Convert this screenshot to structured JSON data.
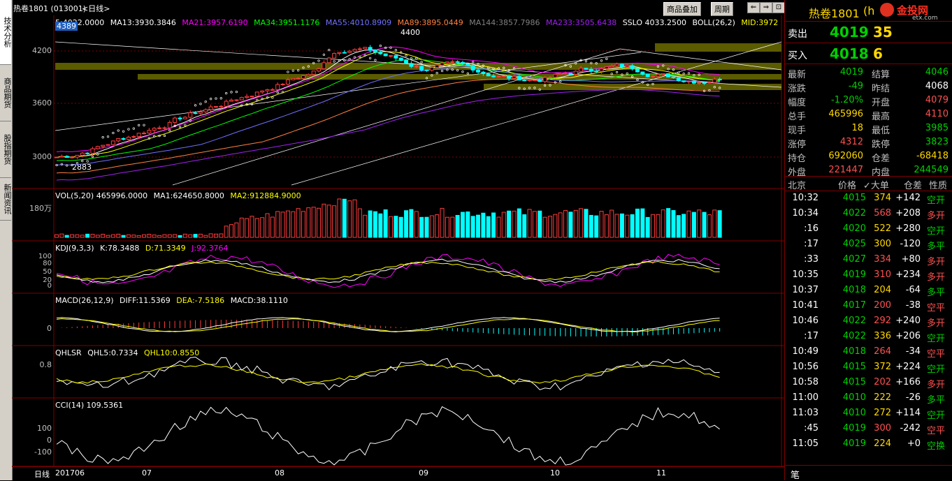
{
  "left_tabs": [
    "技术分析",
    "商品期货",
    "股指期货",
    "新闻资讯"
  ],
  "title": {
    "symbol": "热卷1801 (013001)",
    "period": "<日线>",
    "btn_overlay": "商品叠加",
    "btn_period": "周期"
  },
  "ma_header": {
    "close": "5:4022.0000",
    "ma13": "MA13:3930.3846",
    "ma21": "MA21:3957.6190",
    "ma34": "MA34:3951.1176",
    "ma55": "MA55:4010.8909",
    "ma89": "MA89:3895.0449",
    "ma144": "MA144:3857.7986",
    "ma233": "MA233:3505.6438",
    "sslo": "SSLO 4033.2500",
    "boll": "BOLL(26,2)",
    "mid": "MID:3972",
    "price_tag": "4389"
  },
  "price_axis": [
    "4200",
    "3600",
    "3000"
  ],
  "price_marks": {
    "high": "4400",
    "low": "2883"
  },
  "vol_header": {
    "label": "VOL(5,20) 465996.0000",
    "ma1": "MA1:624650.8000",
    "ma2": "MA2:912884.9000",
    "axis": "180万"
  },
  "kdj_header": {
    "label": "KDJ(9,3,3)",
    "k": "K:78.3488",
    "d": "D:71.3349",
    "j": "J:92.3764",
    "axis": [
      "100",
      "80",
      "50",
      "20",
      "0"
    ]
  },
  "macd_header": {
    "label": "MACD(26,12,9)",
    "diff": "DIFF:11.5369",
    "dea": "DEA:-7.5186",
    "macd": "MACD:38.1110",
    "axis": "0"
  },
  "qhlsr_header": {
    "label": "QHLSR",
    "q5": "QHL5:0.7334",
    "q10": "QHL10:0.8550",
    "axis": "0.8"
  },
  "cci_header": {
    "label": "CCI(14) 109.5361",
    "axis": [
      "100",
      "0",
      "-100"
    ]
  },
  "x_axis": {
    "label": "日线",
    "ticks": [
      "201706",
      "07",
      "08",
      "09",
      "10",
      "11"
    ]
  },
  "colors": {
    "up": "#ff3c3c",
    "down": "#00ffff",
    "ma13": "#ffffff",
    "ma21": "#ff00ff",
    "ma34": "#00ff00",
    "ma55": "#7070ff",
    "ma89": "#ff8040",
    "ma144": "#808080",
    "ma233": "#a020f0",
    "boll": "#ffd800",
    "mid": "#ffff00"
  },
  "quote": {
    "name": "热卷1801",
    "code": "(h",
    "brand": "金投网",
    "brand_sub": "etx.com",
    "sell": {
      "label": "卖出",
      "price": "4019",
      "vol": "35"
    },
    "buy": {
      "label": "买入",
      "price": "4018",
      "vol": "6"
    },
    "stats": [
      {
        "l1": "最新",
        "v1": "4019",
        "c1": "green",
        "l2": "结算",
        "v2": "4046",
        "c2": "green"
      },
      {
        "l1": "涨跌",
        "v1": "-49",
        "c1": "green",
        "l2": "昨结",
        "v2": "4068",
        "c2": "white"
      },
      {
        "l1": "幅度",
        "v1": "-1.20%",
        "c1": "green",
        "l2": "开盘",
        "v2": "4079",
        "c2": "red"
      },
      {
        "l1": "总手",
        "v1": "465996",
        "c1": "yellow",
        "l2": "最高",
        "v2": "4110",
        "c2": "red"
      },
      {
        "l1": "现手",
        "v1": "18",
        "c1": "yellow",
        "l2": "最低",
        "v2": "3985",
        "c2": "green"
      },
      {
        "l1": "涨停",
        "v1": "4312",
        "c1": "red",
        "l2": "跌停",
        "v2": "3823",
        "c2": "green"
      },
      {
        "l1": "持仓",
        "v1": "692060",
        "c1": "yellow",
        "l2": "仓差",
        "v2": "-68418",
        "c2": "yellow"
      },
      {
        "l1": "外盘",
        "v1": "221447",
        "c1": "red",
        "l2": "内盘",
        "v2": "244549",
        "c2": "green"
      }
    ],
    "tick_header": {
      "time": "北京",
      "price": "价格",
      "vol": "✓大单",
      "oi": "仓差",
      "nature": "性质"
    },
    "ticks": [
      {
        "t": "10:32",
        "p": "4015",
        "v": "374",
        "oi": "+142",
        "n": "空开",
        "vc": "yellow",
        "nc": "green"
      },
      {
        "t": "10:34",
        "p": "4022",
        "v": "568",
        "oi": "+208",
        "n": "多开",
        "vc": "red",
        "nc": "red"
      },
      {
        "t": ":16",
        "p": "4020",
        "v": "522",
        "oi": "+280",
        "n": "空开",
        "vc": "yellow",
        "nc": "green"
      },
      {
        "t": ":17",
        "p": "4025",
        "v": "300",
        "oi": "-120",
        "n": "多平",
        "vc": "yellow",
        "nc": "green"
      },
      {
        "t": ":33",
        "p": "4027",
        "v": "334",
        "oi": "+80",
        "n": "多开",
        "vc": "red",
        "nc": "red"
      },
      {
        "t": "10:35",
        "p": "4019",
        "v": "310",
        "oi": "+234",
        "n": "多开",
        "vc": "red",
        "nc": "red"
      },
      {
        "t": "10:37",
        "p": "4018",
        "v": "204",
        "oi": "-64",
        "n": "多平",
        "vc": "yellow",
        "nc": "green"
      },
      {
        "t": "10:41",
        "p": "4017",
        "v": "200",
        "oi": "-38",
        "n": "空平",
        "vc": "red",
        "nc": "red"
      },
      {
        "t": "10:46",
        "p": "4022",
        "v": "292",
        "oi": "+240",
        "n": "多开",
        "vc": "red",
        "nc": "red"
      },
      {
        "t": ":17",
        "p": "4022",
        "v": "336",
        "oi": "+206",
        "n": "空开",
        "vc": "yellow",
        "nc": "green"
      },
      {
        "t": "10:49",
        "p": "4018",
        "v": "264",
        "oi": "-34",
        "n": "空平",
        "vc": "red",
        "nc": "red"
      },
      {
        "t": "10:56",
        "p": "4015",
        "v": "372",
        "oi": "+224",
        "n": "空开",
        "vc": "yellow",
        "nc": "green"
      },
      {
        "t": "10:58",
        "p": "4015",
        "v": "202",
        "oi": "+166",
        "n": "多开",
        "vc": "red",
        "nc": "red"
      },
      {
        "t": "11:00",
        "p": "4010",
        "v": "222",
        "oi": "-26",
        "n": "多平",
        "vc": "yellow",
        "nc": "green"
      },
      {
        "t": "11:03",
        "p": "4010",
        "v": "272",
        "oi": "+114",
        "n": "空开",
        "vc": "yellow",
        "nc": "green"
      },
      {
        "t": ":45",
        "p": "4019",
        "v": "300",
        "oi": "-242",
        "n": "空平",
        "vc": "red",
        "nc": "red"
      },
      {
        "t": "11:05",
        "p": "4019",
        "v": "224",
        "oi": "+0",
        "n": "空换",
        "vc": "yellow",
        "nc": "green"
      }
    ],
    "bottom_label": "笔"
  }
}
